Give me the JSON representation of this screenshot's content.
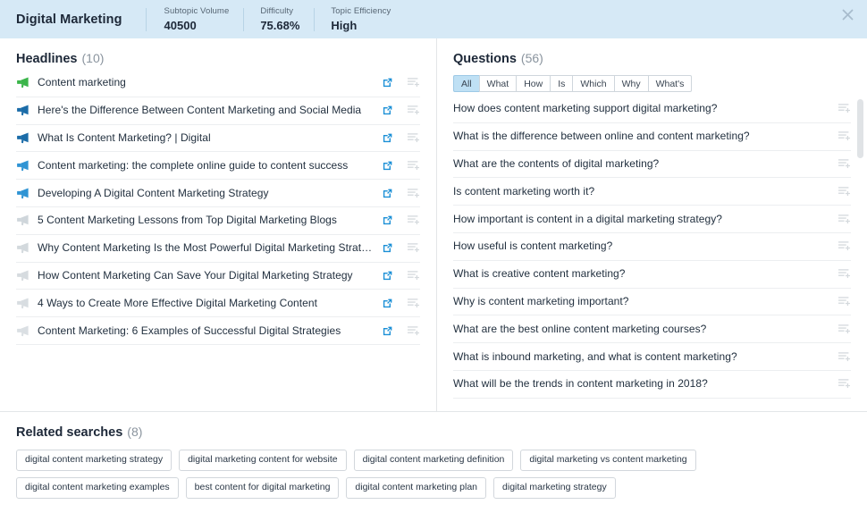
{
  "header": {
    "title": "Digital Marketing",
    "close_icon": "close-icon",
    "stats": [
      {
        "label": "Subtopic Volume",
        "value": "40500"
      },
      {
        "label": "Difficulty",
        "value": "75.68%"
      },
      {
        "label": "Topic Efficiency",
        "value": "High"
      }
    ]
  },
  "headlines": {
    "title": "Headlines",
    "count": "(10)",
    "add_icon": "add-to-list-icon",
    "link_icon": "external-link-icon",
    "bullet_icon": "megaphone-icon",
    "items": [
      {
        "text": "Content marketing",
        "color": "#3bb54a"
      },
      {
        "text": "Here's the Difference Between Content Marketing and Social Media",
        "color": "#1b6ca8"
      },
      {
        "text": "What Is Content Marketing? | Digital",
        "color": "#1b6ca8"
      },
      {
        "text": "Content marketing: the complete online guide to content success",
        "color": "#2f94d4"
      },
      {
        "text": "Developing A Digital Content Marketing Strategy",
        "color": "#2f94d4"
      },
      {
        "text": "5 Content Marketing Lessons from Top Digital Marketing Blogs",
        "color": "#cfd6db"
      },
      {
        "text": "Why Content Marketing Is the Most Powerful Digital Marketing Strategy",
        "color": "#d3d9dd"
      },
      {
        "text": "How Content Marketing Can Save Your Digital Marketing Strategy",
        "color": "#d6dbdf"
      },
      {
        "text": "4 Ways to Create More Effective Digital Marketing Content",
        "color": "#d8dde1"
      },
      {
        "text": "Content Marketing: 6 Examples of Successful Digital Strategies",
        "color": "#dadfe3"
      }
    ]
  },
  "questions": {
    "title": "Questions",
    "count": "(56)",
    "add_icon": "add-to-list-icon",
    "active_tab": "All",
    "tabs": [
      "All",
      "What",
      "How",
      "Is",
      "Which",
      "Why",
      "What's"
    ],
    "items": [
      "How does content marketing support digital marketing?",
      "What is the difference between online and content marketing?",
      "What are the contents of digital marketing?",
      "Is content marketing worth it?",
      "How important is content in a digital marketing strategy?",
      "How useful is content marketing?",
      "What is creative content marketing?",
      "Why is content marketing important?",
      "What are the best online content marketing courses?",
      "What is inbound marketing, and what is content marketing?",
      "What will be the trends in content marketing in 2018?"
    ]
  },
  "related": {
    "title": "Related searches",
    "count": "(8)",
    "items": [
      "digital content marketing strategy",
      "digital marketing content for website",
      "digital content marketing definition",
      "digital marketing vs content marketing",
      "digital content marketing examples",
      "best content for digital marketing",
      "digital content marketing plan",
      "digital marketing strategy"
    ]
  },
  "colors": {
    "header_bg": "#d6e9f6",
    "accent": "#2f94d4",
    "tab_active": "#bfe0f4",
    "border": "#e3e6e8"
  }
}
